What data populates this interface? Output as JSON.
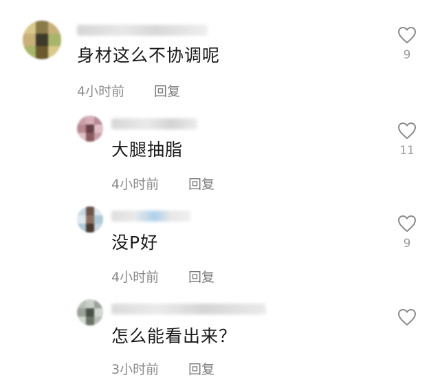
{
  "comments": [
    {
      "text": "身材这么不协调呢",
      "time": "4小时前",
      "reply_label": "回复",
      "likes": "9",
      "avatar_colors": [
        "#d9c98a",
        "#6b5a2e",
        "#a9b56a",
        "#3d3a2a",
        "#c9b07a",
        "#8a7a4a"
      ]
    },
    {
      "text": "大腿抽脂",
      "time": "4小时前",
      "reply_label": "回复",
      "likes": "11",
      "avatar_colors": [
        "#c9a0a8",
        "#8a5a5f",
        "#e0c0c8",
        "#6a4048",
        "#b88a90",
        "#d8b0b8"
      ]
    },
    {
      "text": "没P好",
      "time": "4小时前",
      "reply_label": "回复",
      "likes": "9",
      "avatar_colors": [
        "#c8d8e0",
        "#4a3a30",
        "#b0c8d8",
        "#8a7060",
        "#e0e8f0",
        "#6a5548"
      ]
    },
    {
      "text": "怎么能看出来？",
      "time": "3小时前",
      "reply_label": "回复",
      "likes": "",
      "avatar_colors": [
        "#b8c0b8",
        "#6a7268",
        "#d0d8d0",
        "#4a5248",
        "#9aa298",
        "#c8d0c8"
      ]
    }
  ],
  "colors": {
    "text": "#1a1a1a",
    "meta": "#8a8a8a",
    "heart_stroke": "#8a8a8a",
    "background": "#ffffff"
  }
}
